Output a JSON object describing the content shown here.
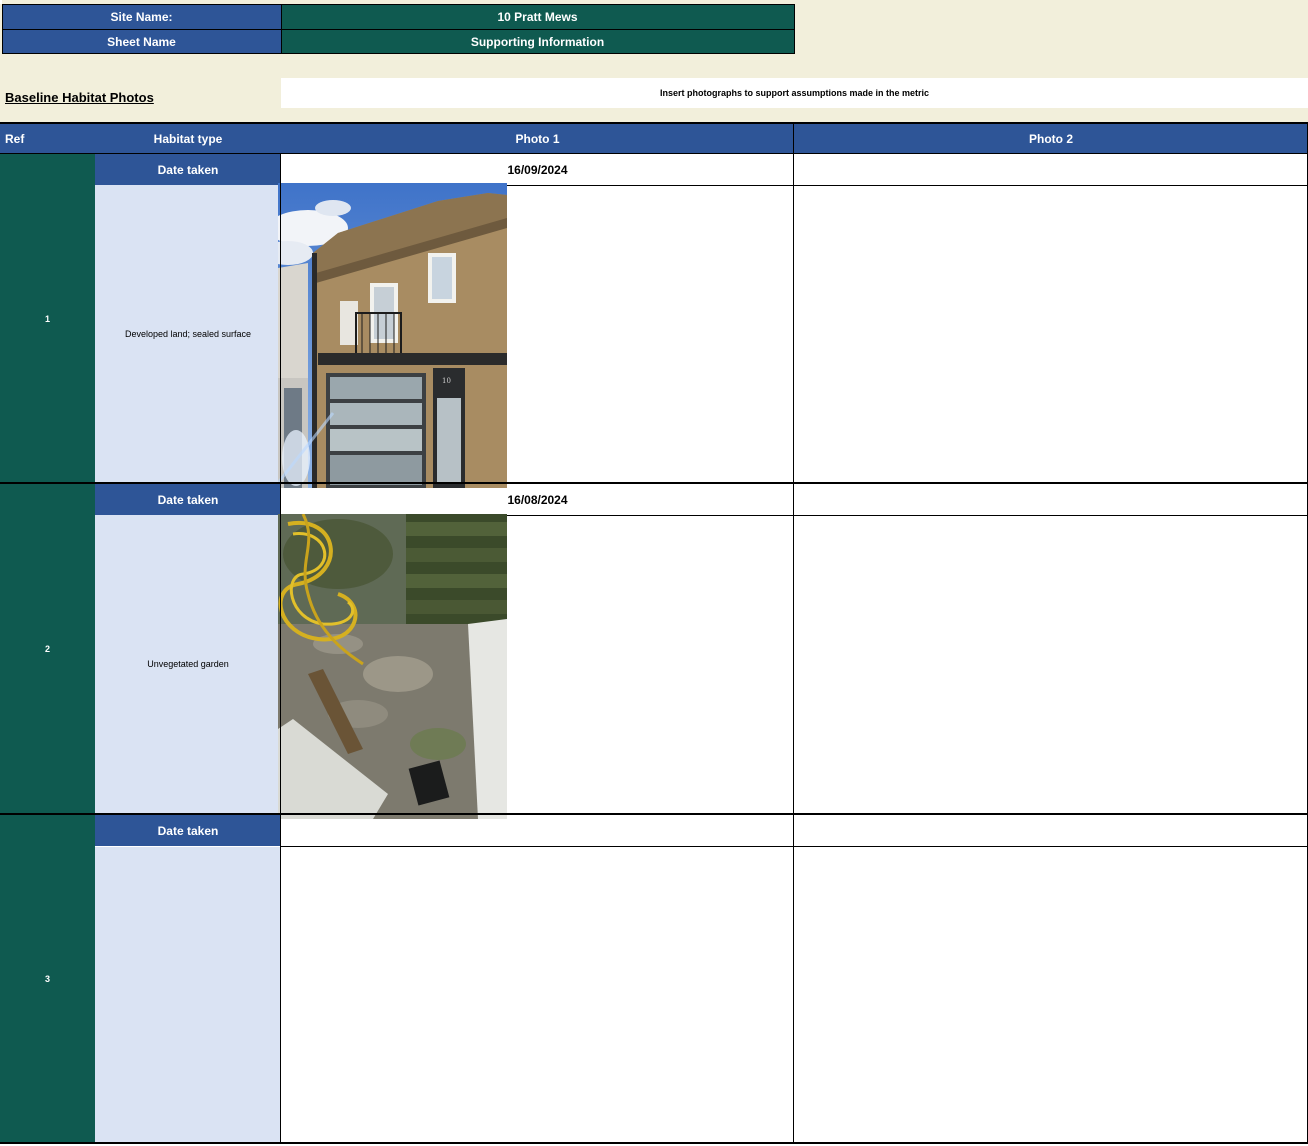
{
  "header": {
    "site_name_label": "Site Name:",
    "site_name_value": "10 Pratt Mews",
    "sheet_name_label": "Sheet Name",
    "sheet_name_value": "Supporting Information"
  },
  "section": {
    "title": "Baseline Habitat Photos",
    "instruction": "Insert photographs to support assumptions made in the metric"
  },
  "table": {
    "columns": [
      "Ref",
      "Habitat type",
      "Photo 1",
      "Photo 2"
    ],
    "date_label": "Date taken",
    "rows": [
      {
        "ref": "1",
        "habitat": "Developed land; sealed surface",
        "photo1_date": "16/09/2024",
        "photo2_date": "",
        "photo1": "building-facade-photo"
      },
      {
        "ref": "2",
        "habitat": "Unvegetated garden",
        "photo1_date": "16/08/2024",
        "photo2_date": "",
        "photo1": "garden-hose-photo"
      },
      {
        "ref": "3",
        "habitat": "",
        "photo1_date": "",
        "photo2_date": ""
      }
    ]
  },
  "colors": {
    "blue_header": "#2e5597",
    "teal": "#0f5a50",
    "light_blue": "#dae3f3",
    "cream": "#f2efdb"
  }
}
